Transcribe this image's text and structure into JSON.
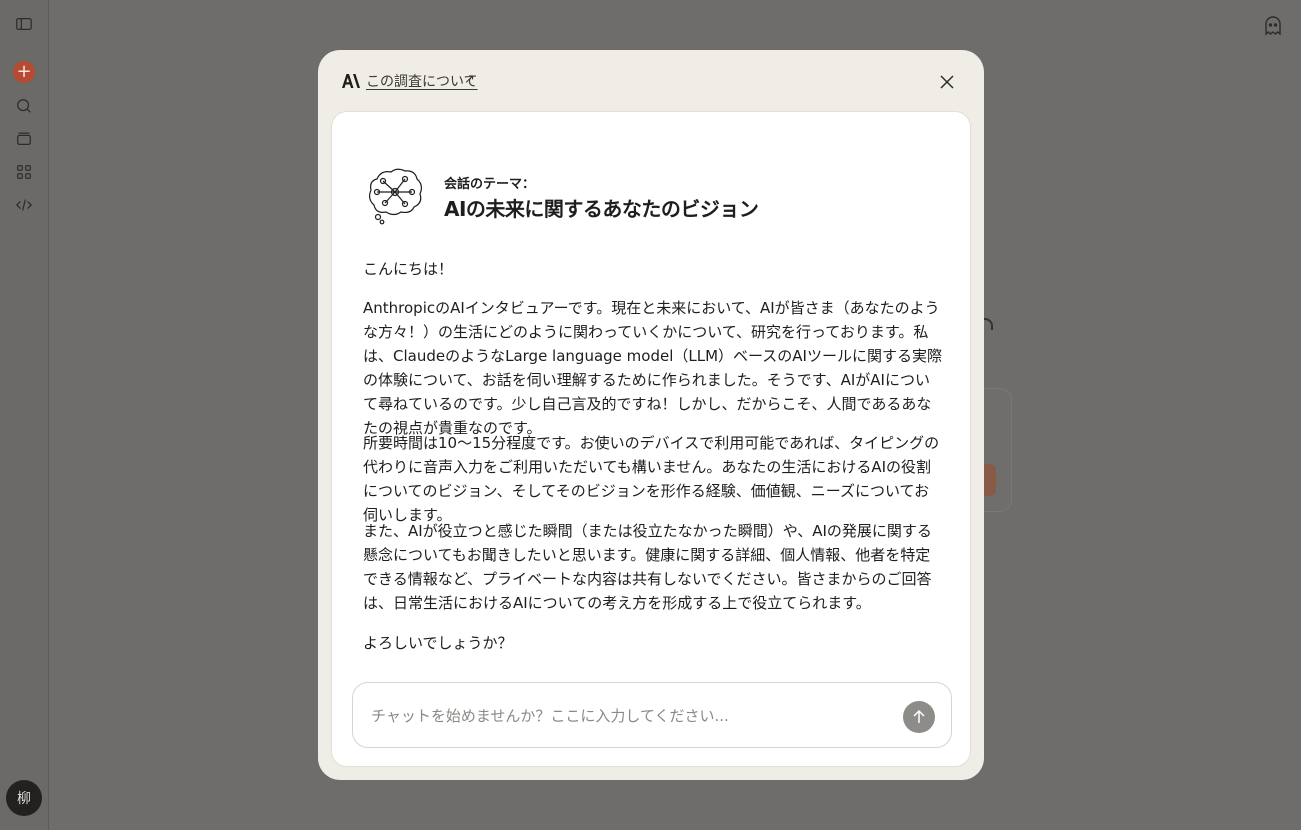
{
  "sidebar": {
    "avatar_initial": "柳"
  },
  "modal": {
    "about_link": "この調査について",
    "about_arrow": "↗",
    "topic_label": "会話のテーマ：",
    "topic_title": "AIの未来に関するあなたのビジョン",
    "paragraphs": [
      "こんにちは！",
      "AnthropicのAIインタビュアーです。現在と未来において、AIが皆さま（あなたのような方々！）の生活にどのように関わっていくかについて、研究を行っております。私は、ClaudeのようなLarge language model（LLM）ベースのAIツールに関する実際の体験について、お話を伺い理解するために作られました。そうです、AIがAIについて尋ねているのです。少し自己言及的ですね！しかし、だからこそ、人間であるあなたの視点が貴重なのです。",
      "所要時間は10〜15分程度です。お使いのデバイスで利用可能であれば、タイピングの代わりに音声入力をご利用いただいても構いません。あなたの生活におけるAIの役割についてのビジョン、そしてそのビジョンを形作る経験、価値観、ニーズについてお伺いします。",
      "また、AIが役立つと感じた瞬間（または役立たなかった瞬間）や、AIの発展に関する懸念についてもお聞きしたいと思います。健康に関する詳細、個人情報、他者を特定できる情報など、プライベートな内容は共有しないでください。皆さまからのご回答は、日常生活におけるAIについての考え方を形成する上で役立てられます。",
      "よろしいでしょうか？"
    ],
    "input": {
      "placeholder": "チャットを始めませんか？ここに入力してください...",
      "value": ""
    }
  },
  "colors": {
    "overlay": "#6e6d6b",
    "modal_bg": "#f0ede7",
    "card_bg": "#ffffff",
    "accent": "#b64a32",
    "send_button": "#8e8c88"
  }
}
